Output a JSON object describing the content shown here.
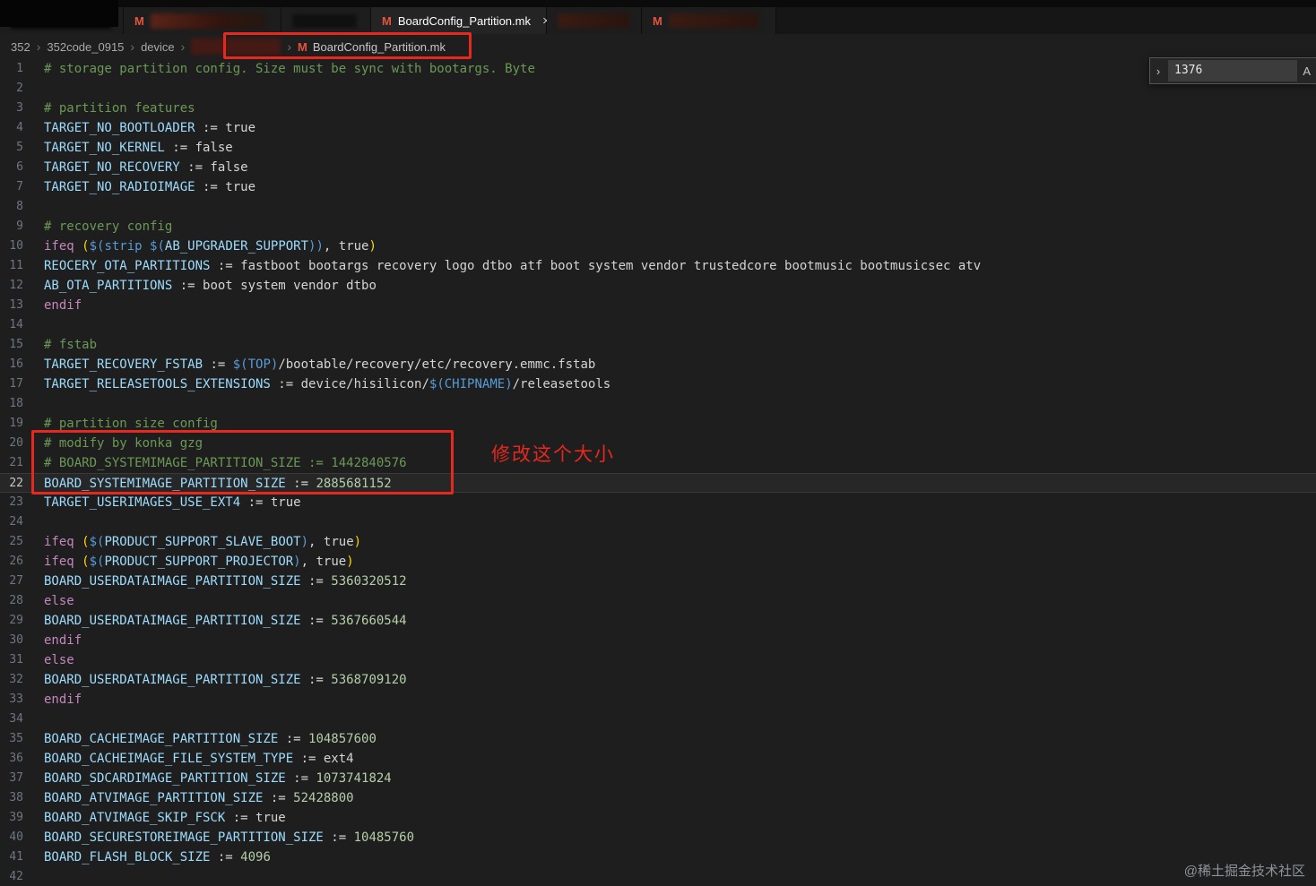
{
  "colors": {
    "annotation_red": "#e6281e",
    "makefile_icon_orange": "#e5533d",
    "editor_background": "#1e1e1e",
    "comment_green": "#6a9955",
    "variable_blue": "#9cdcfe",
    "keyword_magenta": "#c586c0",
    "number_green": "#b5cea8"
  },
  "tabbar": {
    "active_tab": {
      "icon": "M",
      "label": "BoardConfig_Partition.mk",
      "close_glyph": "×"
    },
    "redacted_tab_icons": [
      "M",
      "M"
    ]
  },
  "breadcrumb": {
    "items": [
      "352",
      "352code_0915",
      "device"
    ],
    "separator": "›",
    "file": {
      "icon": "M",
      "label": "BoardConfig_Partition.mk"
    }
  },
  "find_widget": {
    "chevron": "›",
    "value": "1376",
    "case_label": "A"
  },
  "annotation": {
    "note": "修改这个大小"
  },
  "watermark": "@稀土掘金技术社区",
  "editor": {
    "current_line": 22,
    "lines": [
      [
        [
          "# storage partition config. Size must be sync with bootargs. Byte",
          "c"
        ]
      ],
      [],
      [
        [
          "# partition features",
          "c"
        ]
      ],
      [
        [
          "TARGET_NO_BOOTLOADER",
          "v"
        ],
        [
          " := true",
          "o"
        ]
      ],
      [
        [
          "TARGET_NO_KERNEL",
          "v"
        ],
        [
          " := false",
          "o"
        ]
      ],
      [
        [
          "TARGET_NO_RECOVERY",
          "v"
        ],
        [
          " := false",
          "o"
        ]
      ],
      [
        [
          "TARGET_NO_RADIOIMAGE",
          "v"
        ],
        [
          " := true",
          "o"
        ]
      ],
      [],
      [
        [
          "# recovery config",
          "c"
        ]
      ],
      [
        [
          "ifeq ",
          "k"
        ],
        [
          "(",
          "p"
        ],
        [
          "$(",
          "f"
        ],
        [
          "strip ",
          "f"
        ],
        [
          "$(",
          "f"
        ],
        [
          "AB_UPGRADER_SUPPORT",
          "v"
        ],
        [
          "))",
          "f"
        ],
        [
          ", true",
          "o"
        ],
        [
          ")",
          "p"
        ]
      ],
      [
        [
          "REOCERY_OTA_PARTITIONS",
          "v"
        ],
        [
          " := fastboot bootargs recovery logo dtbo atf boot system vendor trustedcore bootmusic bootmusicsec atv",
          "o"
        ]
      ],
      [
        [
          "AB_OTA_PARTITIONS",
          "v"
        ],
        [
          " := boot system vendor dtbo",
          "o"
        ]
      ],
      [
        [
          "endif",
          "k"
        ]
      ],
      [],
      [
        [
          "# fstab",
          "c"
        ]
      ],
      [
        [
          "TARGET_RECOVERY_FSTAB",
          "v"
        ],
        [
          " := ",
          "o"
        ],
        [
          "$(",
          "f"
        ],
        [
          "TOP",
          "f"
        ],
        [
          ")",
          "f"
        ],
        [
          "/bootable/recovery/etc/recovery.emmc.fstab",
          "o"
        ]
      ],
      [
        [
          "TARGET_RELEASETOOLS_EXTENSIONS",
          "v"
        ],
        [
          " := device/hisilicon/",
          "o"
        ],
        [
          "$(",
          "f"
        ],
        [
          "CHIPNAME",
          "f"
        ],
        [
          ")",
          "f"
        ],
        [
          "/releasetools",
          "o"
        ]
      ],
      [],
      [
        [
          "# partition size config",
          "c"
        ]
      ],
      [
        [
          "# modify by konka gzg",
          "c"
        ]
      ],
      [
        [
          "# BOARD_SYSTEMIMAGE_PARTITION_SIZE := 1442840576",
          "c"
        ]
      ],
      [
        [
          "BOARD_SYSTEMIMAGE_PARTITION_SIZE",
          "v"
        ],
        [
          " := ",
          "o"
        ],
        [
          "2885681152",
          "n"
        ]
      ],
      [
        [
          "TARGET_USERIMAGES_USE_EXT4",
          "v"
        ],
        [
          " := true",
          "o"
        ]
      ],
      [],
      [
        [
          "ifeq ",
          "k"
        ],
        [
          "(",
          "p"
        ],
        [
          "$(",
          "f"
        ],
        [
          "PRODUCT_SUPPORT_SLAVE_BOOT",
          "v"
        ],
        [
          ")",
          "f"
        ],
        [
          ", true",
          "o"
        ],
        [
          ")",
          "p"
        ]
      ],
      [
        [
          "ifeq ",
          "k"
        ],
        [
          "(",
          "p"
        ],
        [
          "$(",
          "f"
        ],
        [
          "PRODUCT_SUPPORT_PROJECTOR",
          "v"
        ],
        [
          ")",
          "f"
        ],
        [
          ", true",
          "o"
        ],
        [
          ")",
          "p"
        ]
      ],
      [
        [
          "BOARD_USERDATAIMAGE_PARTITION_SIZE",
          "v"
        ],
        [
          " := ",
          "o"
        ],
        [
          "5360320512",
          "n"
        ]
      ],
      [
        [
          "else",
          "k"
        ]
      ],
      [
        [
          "BOARD_USERDATAIMAGE_PARTITION_SIZE",
          "v"
        ],
        [
          " := ",
          "o"
        ],
        [
          "5367660544",
          "n"
        ]
      ],
      [
        [
          "endif",
          "k"
        ]
      ],
      [
        [
          "else",
          "k"
        ]
      ],
      [
        [
          "BOARD_USERDATAIMAGE_PARTITION_SIZE",
          "v"
        ],
        [
          " := ",
          "o"
        ],
        [
          "5368709120",
          "n"
        ]
      ],
      [
        [
          "endif",
          "k"
        ]
      ],
      [],
      [
        [
          "BOARD_CACHEIMAGE_PARTITION_SIZE",
          "v"
        ],
        [
          " := ",
          "o"
        ],
        [
          "104857600",
          "n"
        ]
      ],
      [
        [
          "BOARD_CACHEIMAGE_FILE_SYSTEM_TYPE",
          "v"
        ],
        [
          " := ext4",
          "o"
        ]
      ],
      [
        [
          "BOARD_SDCARDIMAGE_PARTITION_SIZE",
          "v"
        ],
        [
          " := ",
          "o"
        ],
        [
          "1073741824",
          "n"
        ]
      ],
      [
        [
          "BOARD_ATVIMAGE_PARTITION_SIZE",
          "v"
        ],
        [
          " := ",
          "o"
        ],
        [
          "52428800",
          "n"
        ]
      ],
      [
        [
          "BOARD_ATVIMAGE_SKIP_FSCK",
          "v"
        ],
        [
          " := true",
          "o"
        ]
      ],
      [
        [
          "BOARD_SECURESTOREIMAGE_PARTITION_SIZE",
          "v"
        ],
        [
          " := ",
          "o"
        ],
        [
          "10485760",
          "n"
        ]
      ],
      [
        [
          "BOARD_FLASH_BLOCK_SIZE",
          "v"
        ],
        [
          " := ",
          "o"
        ],
        [
          "4096",
          "n"
        ]
      ],
      []
    ]
  }
}
